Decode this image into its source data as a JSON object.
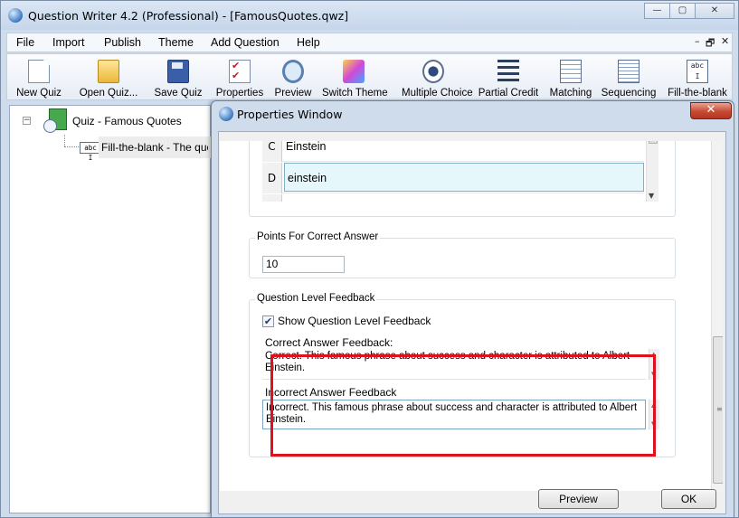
{
  "main_window": {
    "title": "Question Writer 4.2 (Professional) - [FamousQuotes.qwz]",
    "controls": {
      "minimize": "—",
      "restore": "▢",
      "close": "✕"
    }
  },
  "menu": {
    "items": [
      "File",
      "Import",
      "Publish",
      "Theme",
      "Add Question",
      "Help"
    ],
    "mdi_controls": {
      "minimize": "–",
      "restore": "🗗",
      "close": "✕"
    }
  },
  "toolbar": {
    "buttons": [
      {
        "label": "New Quiz",
        "icon": "new-document-icon"
      },
      {
        "label": "Open Quiz...",
        "icon": "open-folder-icon"
      },
      {
        "label": "Save Quiz",
        "icon": "floppy-disk-icon"
      },
      {
        "label": "Properties",
        "icon": "checklist-icon"
      },
      {
        "label": "Preview",
        "icon": "magnifier-icon"
      },
      {
        "label": "Switch Theme",
        "icon": "paint-icon"
      },
      {
        "label": "Multiple Choice",
        "icon": "radio-button-icon"
      },
      {
        "label": "Partial Credit",
        "icon": "list-lines-icon"
      },
      {
        "label": "Matching",
        "icon": "table-grid-icon"
      },
      {
        "label": "Sequencing",
        "icon": "sequence-list-icon"
      },
      {
        "label": "Fill-the-blank",
        "icon": "text-field-icon"
      }
    ]
  },
  "tree": {
    "toggle": "−",
    "quiz_label": "Quiz - Famous Quotes",
    "question_label": "Fill-the-blank - The quote '",
    "question_icon_text": "abc I"
  },
  "properties_dialog": {
    "title": "Properties Window",
    "close": "✕",
    "answers": [
      {
        "letter": "C",
        "value": "Einstein"
      },
      {
        "letter": "D",
        "value": "einstein"
      }
    ],
    "points": {
      "label": "Points For Correct Answer",
      "value": "10"
    },
    "feedback": {
      "group_label": "Question Level Feedback",
      "checkbox_label": "Show Question Level Feedback",
      "checkbox_checked": true,
      "check_mark": "✔",
      "correct_label": "Correct Answer Feedback:",
      "correct_text": "Correct. This famous phrase about success and character is attributed to Albert Einstein.",
      "incorrect_label": "Incorrect Answer Feedback",
      "incorrect_text": "Incorrect. This famous phrase about success and character is attributed to Albert Einstein."
    },
    "buttons": {
      "preview": "Preview",
      "ok": "OK"
    },
    "highlight_color": "#e0101e"
  }
}
